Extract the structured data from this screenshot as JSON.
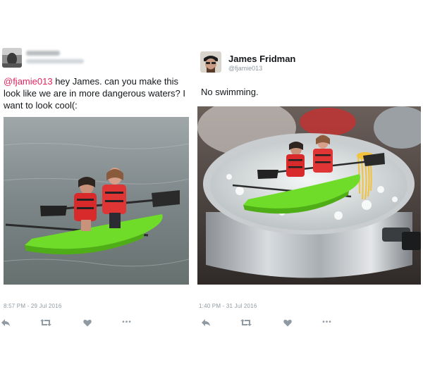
{
  "left_tweet": {
    "mention": "@fjamie013",
    "text": " hey James. can you make this look like we are in more dangerous waters? I want to look cool(:",
    "timestamp": "8:57 PM - 29 Jul 2016",
    "photo_icon": "kayak-photo"
  },
  "right_tweet": {
    "author_name": "James Fridman",
    "author_handle": "@fjamie013",
    "text": "No swimming.",
    "timestamp": "1:40 PM - 31 Jul 2016",
    "photo_icon": "kayak-in-boiling-pot-photo"
  },
  "actions": [
    "reply-icon",
    "retweet-icon",
    "like-icon",
    "more-icon"
  ],
  "colors": {
    "mention": "#e0245e",
    "meta_text": "#8f9aa3",
    "kayak": "#6fdc2a"
  }
}
